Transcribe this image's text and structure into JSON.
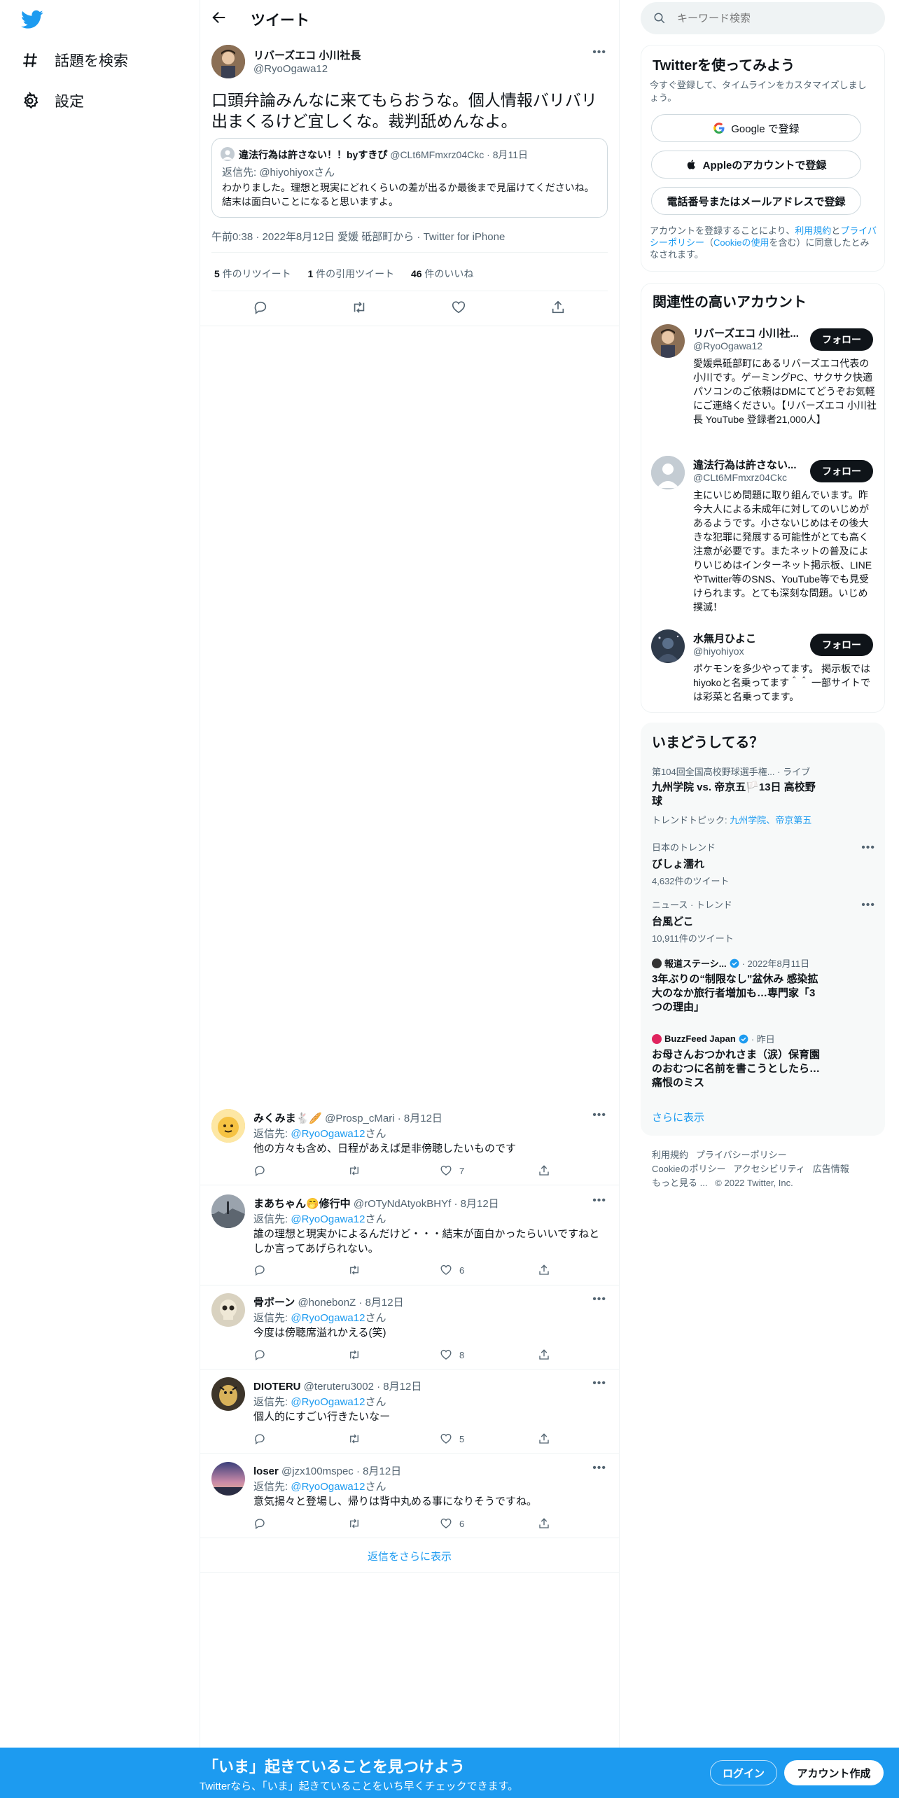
{
  "nav": {
    "items": [
      {
        "label": "話題を検索",
        "icon": "hashtag-icon"
      },
      {
        "label": "設定",
        "icon": "gear-icon"
      }
    ]
  },
  "header": {
    "title": "ツイート"
  },
  "tweet": {
    "author_name": "リバーズエコ 小川社長",
    "author_handle": "@RyoOgawa12",
    "text": "口頭弁論みんなに来てもらおうな。個人情報バリバリ出まくるけど宜しくな。裁判舐めんなよ。",
    "quote": {
      "author_name": "違法行為は許さない！！byすきぴ",
      "author_handle": "@CLt6MFmxrz04Ckc",
      "date": "· 8月11日",
      "replying_to": "返信先: @hiyohiyoxさん",
      "text": "わかりました。理想と現実にどれくらいの差が出るか最後まで見届けてくださいね。結末は面白いことになると思いますよ。"
    },
    "meta": "午前0:38 · 2022年8月12日 愛媛 砥部町から · Twitter for iPhone",
    "stats": [
      {
        "count": "5",
        "label": "件のリツイート"
      },
      {
        "count": "1",
        "label": "件の引用ツイート"
      },
      {
        "count": "46",
        "label": "件のいいね"
      }
    ]
  },
  "replies": [
    {
      "name": "みくみま🐇🥖",
      "handle": "@Prosp_cMari",
      "date": "· 8月12日",
      "replying_prefix": "返信先:",
      "replying_handle": "@RyoOgawa12",
      "replying_suffix": "さん",
      "text": "他の方々も含め、日程があえば是非傍聴したいものです",
      "likes": "7",
      "avatar_color": "#f6c343"
    },
    {
      "name": "まあちゃん🤭修行中",
      "handle": "@rOTyNdAtyokBHYf",
      "date": "· 8月12日",
      "replying_prefix": "返信先:",
      "replying_handle": "@RyoOgawa12",
      "replying_suffix": "さん",
      "text": "誰の理想と現実かによるんだけど・・・結末が面白かったらいいですねとしか言ってあげられない。",
      "likes": "6",
      "avatar_color": "#6b7480"
    },
    {
      "name": "骨ボーン",
      "handle": "@honebonZ",
      "date": "· 8月12日",
      "replying_prefix": "返信先:",
      "replying_handle": "@RyoOgawa12",
      "replying_suffix": "さん",
      "text": "今度は傍聴席溢れかえる(笑)",
      "likes": "8",
      "avatar_color": "#c8b896"
    },
    {
      "name": "DIOTERU",
      "handle": "@teruteru3002",
      "date": "· 8月12日",
      "replying_prefix": "返信先:",
      "replying_handle": "@RyoOgawa12",
      "replying_suffix": "さん",
      "text": "個人的にすごい行きたいなー",
      "likes": "5",
      "avatar_color": "#4a4030"
    },
    {
      "name": "loser",
      "handle": "@jzx100mspec",
      "date": "· 8月12日",
      "replying_prefix": "返信先:",
      "replying_handle": "@RyoOgawa12",
      "replying_suffix": "さん",
      "text": "意気揚々と登場し、帰りは背中丸める事になりそうですね。",
      "likes": "6",
      "avatar_color": "#7a6a9a"
    }
  ],
  "show_more_replies": "返信をさらに表示",
  "search": {
    "placeholder": "キーワード検索"
  },
  "signup_card": {
    "title": "Twitterを使ってみよう",
    "subtitle": "今すぐ登録して、タイムラインをカスタマイズしましょう。",
    "google": "Google で登録",
    "apple": "Appleのアカウントで登録",
    "phone": "電話番号またはメールアドレスで登録",
    "legal_prefix": "アカウントを登録することにより、",
    "legal_terms": "利用規約",
    "legal_and": "と",
    "legal_privacy": "プライバシーポリシー",
    "legal_paren_open": "（",
    "legal_cookie": "Cookieの使用",
    "legal_suffix": "を含む）に同意したとみなされます。"
  },
  "related": {
    "title": "関連性の高いアカウント",
    "follow_label": "フォロー",
    "accounts": [
      {
        "name": "リバーズエコ 小川社...",
        "handle": "@RyoOgawa12",
        "bio": "愛媛県砥部町にあるリバーズエコ代表の小川です。ゲーミングPC、サクサク快適パソコンのご依頼はDMにてどうぞお気軽にご連絡ください。【リバーズエコ 小川社長 YouTube 登録者21,000人】"
      },
      {
        "name": "違法行為は許さない...",
        "handle": "@CLt6MFmxrz04Ckc",
        "bio": "主にいじめ問題に取り組んでいます。昨今大人による未成年に対してのいじめがあるようです。小さないじめはその後大きな犯罪に発展する可能性がとても高く注意が必要です。またネットの普及によりいじめはインターネット掲示板、LINEやTwitter等のSNS、YouTube等でも見受けられます。とても深刻な問題。いじめ撲滅！"
      },
      {
        "name": "水無月ひよこ",
        "handle": "@hiyohiyox",
        "bio": "ポケモンを多少やってます。 掲示板ではhiyokoと名乗ってます＾＾ 一部サイトでは彩菜と名乗ってます。"
      }
    ]
  },
  "trends": {
    "title": "いまどうしてる？",
    "items": [
      {
        "context": "第104回全国高校野球選手権...",
        "badge": "· ライブ",
        "title": "九州学院 vs. 帝京五🏳️13日 高校野球",
        "topic_prefix": "トレンドトピック:",
        "topic_links": "九州学院、帝京第五"
      },
      {
        "context": "日本のトレンド",
        "title": "びしょ濡れ",
        "count": "4,632件のツイート"
      },
      {
        "context": "ニュース · トレンド",
        "title": "台風どこ",
        "count": "10,911件のツイート"
      },
      {
        "source": "報道ステーシ...",
        "date": "· 2022年8月11日",
        "title": "3年ぶりの“制限なし”盆休み 感染拡大のなか旅行者増加も…専門家「3つの理由」"
      },
      {
        "source": "BuzzFeed Japan",
        "date": "· 昨日",
        "title": "お母さんおつかれさま（涙）保育園のおむつに名前を書こうとしたら…痛恨のミス"
      }
    ],
    "show_more": "さらに表示"
  },
  "footer": {
    "links": [
      "利用規約",
      "プライバシーポリシー",
      "Cookieのポリシー",
      "アクセシビリティ",
      "広告情報",
      "もっと見る ..."
    ],
    "copyright": "© 2022 Twitter, Inc."
  },
  "bottom_bar": {
    "headline": "「いま」起きていることを見つけよう",
    "sub": "Twitterなら、「いま」起きていることをいち早くチェックできます。",
    "login": "ログイン",
    "signup": "アカウント作成"
  },
  "colors": {
    "accent": "#1d9bf0",
    "text": "#0f1419",
    "muted": "#536471",
    "border": "#eff3f4"
  }
}
